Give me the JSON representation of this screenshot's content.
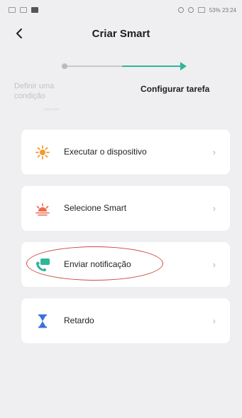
{
  "status_bar": {
    "right_text": "53% 23:24"
  },
  "header": {
    "title": "Criar Smart",
    "back_icon": "chevron-left-icon"
  },
  "steps": {
    "step1_label": "Definir uma condição",
    "step1_sub": "xxxx xxxx",
    "step2_label": "Configurar tarefa",
    "colors": {
      "active": "#2fb59a",
      "inactive": "#c9c9c9"
    }
  },
  "options": [
    {
      "label": "Executar o dispositivo",
      "icon": "sun-icon",
      "color": "#f39a2e"
    },
    {
      "label": "Selecione Smart",
      "icon": "sunrise-icon",
      "color": "#ee6b4d"
    },
    {
      "label": "Enviar notificação",
      "icon": "notification-icon",
      "color": "#2fb59a",
      "highlighted": true
    },
    {
      "label": "Retardo",
      "icon": "hourglass-icon",
      "color": "#3a6fe0"
    }
  ],
  "highlight_color": "#cf4a42"
}
